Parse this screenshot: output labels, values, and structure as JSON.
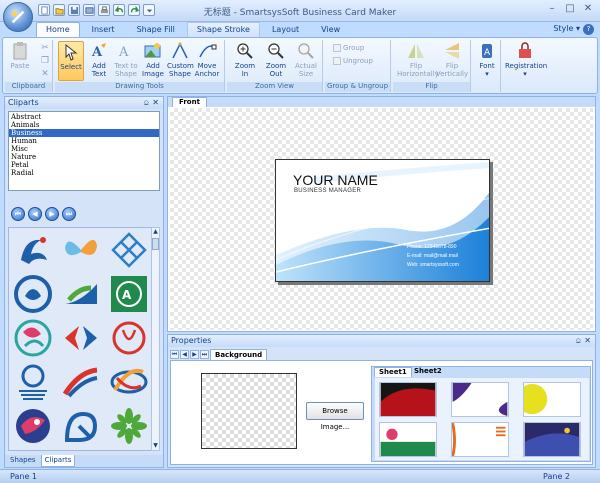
{
  "window": {
    "title": "无标题 - SmartsysSoft Business Card Maker"
  },
  "ribbon_tabs": [
    {
      "label": "Home",
      "active": true
    },
    {
      "label": "Insert"
    },
    {
      "label": "Shape Fill"
    },
    {
      "label": "Shape Stroke"
    },
    {
      "label": "Layout"
    },
    {
      "label": "View"
    }
  ],
  "style_menu": "Style",
  "groups": {
    "clipboard": {
      "label": "Clipboard",
      "paste": "Paste"
    },
    "drawing": {
      "label": "Drawing Tools",
      "select": "Select",
      "add_text": "Add Text",
      "text_to_shape": "Text to Shape",
      "add_image": "Add Image",
      "custom_shape": "Custom Shape",
      "move_anchor": "Move Anchor"
    },
    "zoom": {
      "label": "Zoom View",
      "zoom_in": "Zoom In",
      "zoom_out": "Zoom Out",
      "actual_size": "Actual Size"
    },
    "group": {
      "label": "Group & Ungroup",
      "group": "Group",
      "ungroup": "Ungroup"
    },
    "flip": {
      "label": "Flip",
      "flip_h": "Flip Horizontally",
      "flip_v": "Flip Vertically"
    },
    "font": {
      "label": "Font"
    },
    "registration": {
      "label": "Registration"
    }
  },
  "cliparts_panel": {
    "title": "Cliparts",
    "categories": [
      "Abstract",
      "Animals",
      "Business",
      "Human",
      "Misc",
      "Nature",
      "Petal",
      "Radial"
    ],
    "selected_category": "Business",
    "tabs": [
      "Shapes",
      "Cliparts"
    ],
    "active_tab": "Cliparts"
  },
  "document": {
    "tab": "Front",
    "card": {
      "name": "YOUR NAME",
      "role": "BUSINESS MANAGER",
      "phone": "Phone: 12345678-890",
      "email": "E-mail: mail@mail.mail",
      "web": "Web: smartsyssoft.com"
    }
  },
  "properties_panel": {
    "title": "Properties",
    "tab": "Background",
    "browse_button": "Browse Image...",
    "sheets": [
      "Sheet1",
      "Sheet2"
    ],
    "active_sheet": "Sheet1"
  },
  "status": {
    "left": "Pane 1",
    "right": "Pane 2"
  },
  "colors": {
    "accent": "#15428b",
    "ribbon_bg": "#dbe9fb",
    "card_wave": "#2b8fe0"
  }
}
